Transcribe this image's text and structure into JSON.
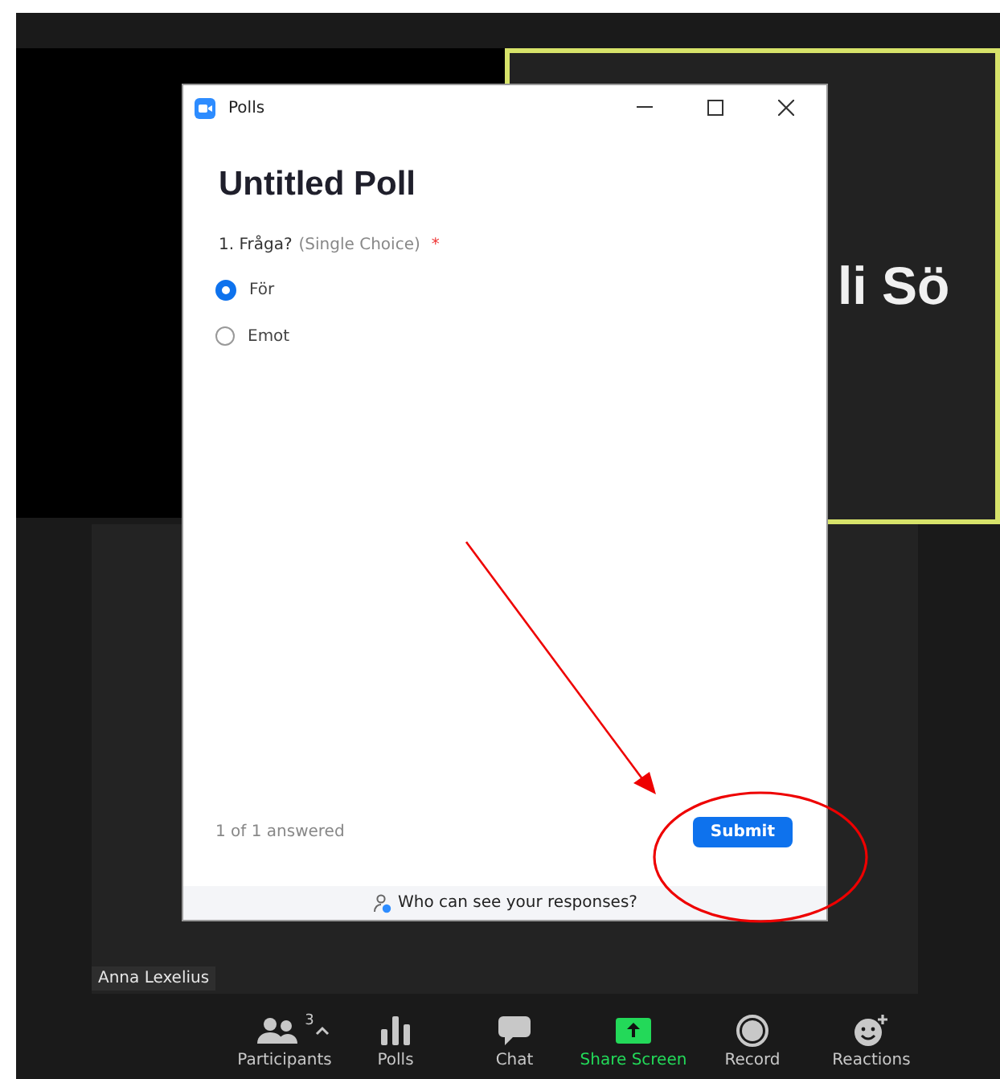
{
  "speaker": {
    "name_fragment": "li Sö"
  },
  "participant_tile": {
    "name": "Anna Lexelius"
  },
  "poll_window": {
    "title": "Polls",
    "heading": "Untitled Poll",
    "question": {
      "title": "1. Fråga?",
      "type": "(Single Choice)",
      "required_mark": "*",
      "options": [
        {
          "label": "För",
          "selected": true
        },
        {
          "label": "Emot",
          "selected": false
        }
      ]
    },
    "progress": "1 of 1 answered",
    "submit": "Submit",
    "privacy_link": "Who can see your responses?"
  },
  "toolbar": [
    {
      "kind": "participants",
      "label": "Participants",
      "count": "3",
      "highlighted": false
    },
    {
      "kind": "polls",
      "label": "Polls",
      "highlighted": false
    },
    {
      "kind": "chat",
      "label": "Chat",
      "highlighted": false
    },
    {
      "kind": "share",
      "label": "Share Screen",
      "highlighted": true
    },
    {
      "kind": "record",
      "label": "Record",
      "highlighted": false
    },
    {
      "kind": "reactions",
      "label": "Reactions",
      "highlighted": false
    }
  ]
}
